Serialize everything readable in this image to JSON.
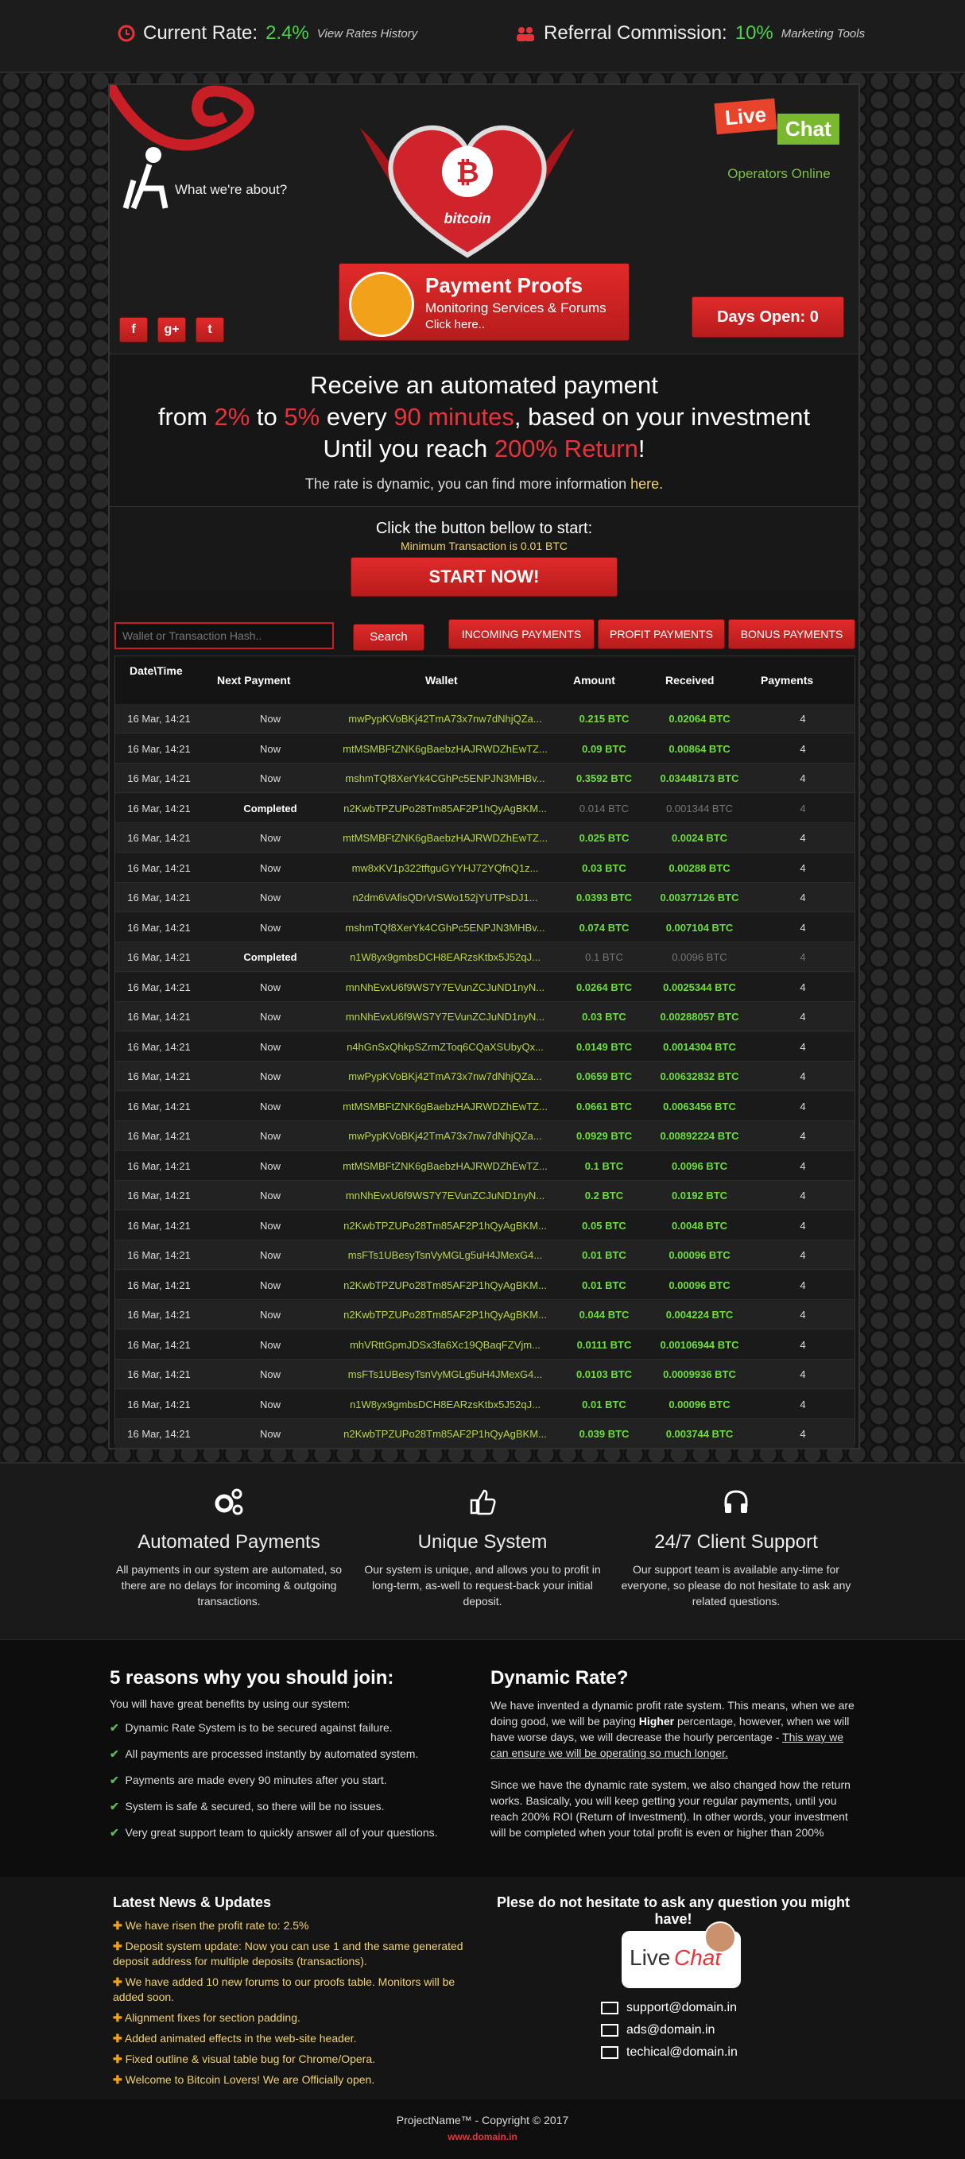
{
  "topbar": {
    "rate_label": "Current Rate:",
    "rate_value": "2.4%",
    "rate_link": "View Rates History",
    "ref_label": "Referral Commission:",
    "ref_value": "10%",
    "ref_link": "Marketing Tools"
  },
  "header": {
    "about": "What we're about?",
    "brand": "bitcoin",
    "livechat_live": "Live",
    "livechat_chat": "Chat",
    "operators": "Operators Online",
    "proofs_title": "Payment Proofs",
    "proofs_sub": "Monitoring Services & Forums",
    "proofs_click": "Click here..",
    "days_open": "Days Open: 0",
    "social": [
      "f",
      "g+",
      "t"
    ]
  },
  "hero": {
    "line1": "Receive an automated payment",
    "from": "from ",
    "min": "2%",
    "to": " to ",
    "max": "5%",
    "every": " every ",
    "interval": "90 minutes",
    "based": ", based on your investment",
    "until": "Until you reach ",
    "ret": "200% Return",
    "excl": "!",
    "note": "The rate is dynamic, you can find more information ",
    "note_link": "here."
  },
  "start": {
    "prompt": "Click the button bellow to start:",
    "minimum": "Minimum Transaction is 0.01 BTC",
    "button": "START NOW!"
  },
  "search": {
    "placeholder": "Wallet or Transaction Hash..",
    "button": "Search"
  },
  "tabs": [
    "INCOMING PAYMENTS",
    "PROFIT PAYMENTS",
    "BONUS PAYMENTS"
  ],
  "table": {
    "headers": [
      "Date\\Time",
      "Next Payment",
      "Wallet",
      "Amount",
      "Received",
      "Payments"
    ],
    "rows": [
      [
        "16 Mar, 14:21",
        "Now",
        "mwPypKVoBKj42TmA73x7nw7dNhjQZa...",
        "0.215 BTC",
        "0.02064 BTC",
        "4"
      ],
      [
        "16 Mar, 14:21",
        "Now",
        "mtMSMBFtZNK6gBaebzHAJRWDZhEwTZ...",
        "0.09 BTC",
        "0.00864 BTC",
        "4"
      ],
      [
        "16 Mar, 14:21",
        "Now",
        "mshmTQf8XerYk4CGhPc5ENPJN3MHBv...",
        "0.3592 BTC",
        "0.03448173 BTC",
        "4"
      ],
      [
        "16 Mar, 14:21",
        "Completed",
        "n2KwbTPZUPo28Tm85AF2P1hQyAgBKM...",
        "0.014 BTC",
        "0.001344 BTC",
        "4"
      ],
      [
        "16 Mar, 14:21",
        "Now",
        "mtMSMBFtZNK6gBaebzHAJRWDZhEwTZ...",
        "0.025 BTC",
        "0.0024 BTC",
        "4"
      ],
      [
        "16 Mar, 14:21",
        "Now",
        "mw8xKV1p322tftguGYYHJ72YQfnQ1z...",
        "0.03 BTC",
        "0.00288 BTC",
        "4"
      ],
      [
        "16 Mar, 14:21",
        "Now",
        "n2dm6VAfisQDrVrSWo152jYUTPsDJ1...",
        "0.0393 BTC",
        "0.00377126 BTC",
        "4"
      ],
      [
        "16 Mar, 14:21",
        "Now",
        "mshmTQf8XerYk4CGhPc5ENPJN3MHBv...",
        "0.074 BTC",
        "0.007104 BTC",
        "4"
      ],
      [
        "16 Mar, 14:21",
        "Completed",
        "n1W8yx9gmbsDCH8EARzsKtbx5J52qJ...",
        "0.1 BTC",
        "0.0096 BTC",
        "4"
      ],
      [
        "16 Mar, 14:21",
        "Now",
        "mnNhEvxU6f9WS7Y7EVunZCJuND1nyN...",
        "0.0264 BTC",
        "0.0025344 BTC",
        "4"
      ],
      [
        "16 Mar, 14:21",
        "Now",
        "mnNhEvxU6f9WS7Y7EVunZCJuND1nyN...",
        "0.03 BTC",
        "0.00288057 BTC",
        "4"
      ],
      [
        "16 Mar, 14:21",
        "Now",
        "n4hGnSxQhkpSZrmZToq6CQaXSUbyQx...",
        "0.0149 BTC",
        "0.0014304 BTC",
        "4"
      ],
      [
        "16 Mar, 14:21",
        "Now",
        "mwPypKVoBKj42TmA73x7nw7dNhjQZa...",
        "0.0659 BTC",
        "0.00632832 BTC",
        "4"
      ],
      [
        "16 Mar, 14:21",
        "Now",
        "mtMSMBFtZNK6gBaebzHAJRWDZhEwTZ...",
        "0.0661 BTC",
        "0.0063456 BTC",
        "4"
      ],
      [
        "16 Mar, 14:21",
        "Now",
        "mwPypKVoBKj42TmA73x7nw7dNhjQZa...",
        "0.0929 BTC",
        "0.00892224 BTC",
        "4"
      ],
      [
        "16 Mar, 14:21",
        "Now",
        "mtMSMBFtZNK6gBaebzHAJRWDZhEwTZ...",
        "0.1 BTC",
        "0.0096 BTC",
        "4"
      ],
      [
        "16 Mar, 14:21",
        "Now",
        "mnNhEvxU6f9WS7Y7EVunZCJuND1nyN...",
        "0.2 BTC",
        "0.0192 BTC",
        "4"
      ],
      [
        "16 Mar, 14:21",
        "Now",
        "n2KwbTPZUPo28Tm85AF2P1hQyAgBKM...",
        "0.05 BTC",
        "0.0048 BTC",
        "4"
      ],
      [
        "16 Mar, 14:21",
        "Now",
        "msFTs1UBesyTsnVyMGLg5uH4JMexG4...",
        "0.01 BTC",
        "0.00096 BTC",
        "4"
      ],
      [
        "16 Mar, 14:21",
        "Now",
        "n2KwbTPZUPo28Tm85AF2P1hQyAgBKM...",
        "0.01 BTC",
        "0.00096 BTC",
        "4"
      ],
      [
        "16 Mar, 14:21",
        "Now",
        "n2KwbTPZUPo28Tm85AF2P1hQyAgBKM...",
        "0.044 BTC",
        "0.004224 BTC",
        "4"
      ],
      [
        "16 Mar, 14:21",
        "Now",
        "mhVRttGpmJDSx3fa6Xc19QBaqFZVjm...",
        "0.0111 BTC",
        "0.00106944 BTC",
        "4"
      ],
      [
        "16 Mar, 14:21",
        "Now",
        "msFTs1UBesyTsnVyMGLg5uH4JMexG4...",
        "0.0103 BTC",
        "0.0009936 BTC",
        "4"
      ],
      [
        "16 Mar, 14:21",
        "Now",
        "n1W8yx9gmbsDCH8EARzsKtbx5J52qJ...",
        "0.01 BTC",
        "0.00096 BTC",
        "4"
      ],
      [
        "16 Mar, 14:21",
        "Now",
        "n2KwbTPZUPo28Tm85AF2P1hQyAgBKM...",
        "0.039 BTC",
        "0.003744 BTC",
        "4"
      ]
    ]
  },
  "features": [
    {
      "icon": "gears-icon",
      "title": "Automated Payments",
      "desc": "All payments in our system are automated, so there are no delays for incoming & outgoing transactions."
    },
    {
      "icon": "thumbs-up-icon",
      "title": "Unique System",
      "desc": "Our system is unique, and allows you to profit in long-term, as-well to request-back your initial deposit."
    },
    {
      "icon": "headphones-icon",
      "title": "24/7 Client Support",
      "desc": "Our support team is available any-time for everyone, so please do not hesitate to ask any related questions."
    }
  ],
  "reasons": {
    "title": "5 reasons why you should join:",
    "intro": "You will have great benefits by using our system:",
    "items": [
      "Dynamic Rate System is to be secured against failure.",
      "All payments are processed instantly by automated system.",
      "Payments are made every 90 minutes after you start.",
      "System is safe & secured, so there will be no issues.",
      "Very great support team to quickly answer all of your questions."
    ]
  },
  "dynamic": {
    "title": "Dynamic Rate?",
    "p1a": "We have invented a dynamic profit rate system. This means, when we are doing good, we will be paying ",
    "p1b": "Higher",
    "p1c": " percentage, however, when we will have worse days, we will decrease the hourly percentage - ",
    "p1d": "This way we can ensure we will be operating so much longer.",
    "p2": "Since we have the dynamic rate system, we also changed how the return works. Basically, you will keep getting your regular payments, until you reach 200% ROI (Return of Investment). In other words, your investment will be completed when your total profit is even or higher than 200%"
  },
  "news": {
    "title": "Latest News & Updates",
    "items": [
      "We have risen the profit rate to: 2.5%",
      "Deposit system update: Now you can use 1 and the same generated deposit address for multiple deposits (transactions).",
      "We have added 10 new forums to our proofs table. Monitors will be added soon.",
      "Alignment fixes for section padding.",
      "Added animated effects in the web-site header.",
      "Fixed outline & visual table bug for Chrome/Opera.",
      "Welcome to Bitcoin Lovers! We are Officially open."
    ]
  },
  "contact": {
    "title": "Plese do not hesitate to ask any question you might have!",
    "live": "Live",
    "chat": "Chat",
    "emails": [
      "support@domain.in",
      "ads@domain.in",
      "techical@domain.in"
    ]
  },
  "footer": {
    "copyright": "ProjectName™ - Copyright © 2017",
    "domain": "www.domain.in"
  }
}
